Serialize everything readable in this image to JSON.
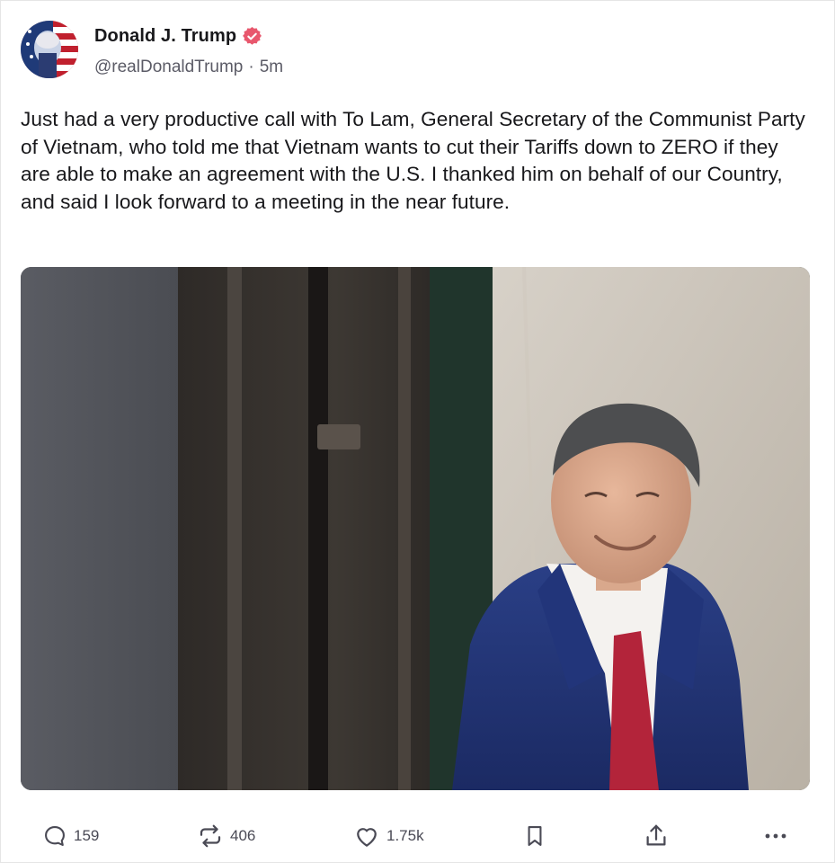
{
  "author": {
    "display_name": "Donald J. Trump",
    "handle": "@realDonaldTrump",
    "separator": "·",
    "timestamp": "5m",
    "verified": true,
    "avatar_icon": "flag-portrait-avatar"
  },
  "post": {
    "text": "Just had a very productive call with To Lam, General Secretary of the Communist Party of Vietnam, who told me that Vietnam wants to cut their Tariffs down to ZERO if they are able to make an agreement with the U.S. I thanked him on behalf of our Country, and said I look forward to a meeting in the near future.",
    "media_description_icon": "photo-man-in-suit"
  },
  "actions": {
    "reply": {
      "icon": "comment-icon",
      "count": "159"
    },
    "retruth": {
      "icon": "repost-icon",
      "count": "406"
    },
    "like": {
      "icon": "heart-icon",
      "count": "1.75k"
    },
    "bookmark": {
      "icon": "bookmark-icon"
    },
    "share": {
      "icon": "share-icon"
    },
    "more": {
      "icon": "more-icon"
    }
  },
  "colors": {
    "verified_badge": "#e8576d",
    "text_primary": "#18181b",
    "text_secondary": "#5b5b66",
    "icon": "#4a4a55"
  }
}
